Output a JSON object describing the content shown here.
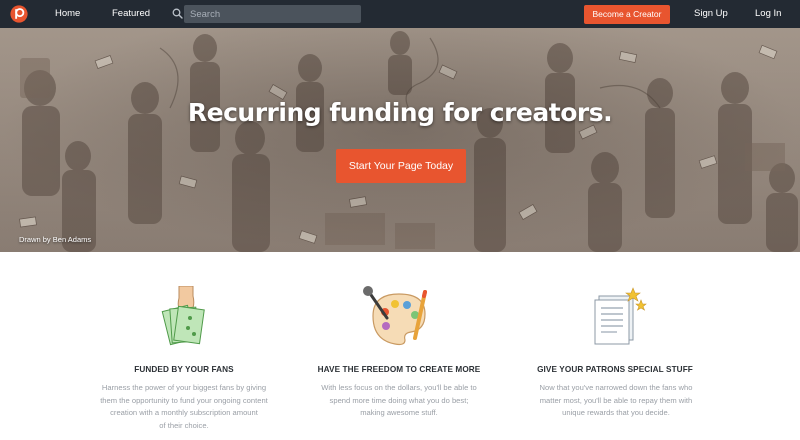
{
  "nav": {
    "home": "Home",
    "featured": "Featured",
    "search_placeholder": "Search",
    "become_creator": "Become a Creator",
    "signup": "Sign Up",
    "login": "Log In"
  },
  "hero": {
    "title": "Recurring funding for creators.",
    "cta": "Start Your Page Today",
    "credit_prefix": "Drawn by",
    "credit_name": "Ben Adams"
  },
  "features": [
    {
      "icon": "money-hand-icon",
      "title": "FUNDED BY YOUR FANS",
      "desc_lines": [
        "Harness the power of your biggest fans by giving",
        "them the opportunity to fund your ongoing content",
        "creation with a monthly subscription amount",
        "of their choice."
      ]
    },
    {
      "icon": "palette-microphone-icon",
      "title": "HAVE THE FREEDOM TO CREATE MORE",
      "desc_lines": [
        "With less focus on the dollars, you'll be able to",
        "spend more time doing what you do best;",
        "making awesome stuff."
      ]
    },
    {
      "icon": "certificate-stars-icon",
      "title": "GIVE YOUR PATRONS SPECIAL STUFF",
      "desc_lines": [
        "Now that you've narrowed down the fans who",
        "matter most, you'll be able to repay them with",
        "unique rewards that you decide."
      ]
    }
  ],
  "colors": {
    "nav_bg": "#232a33",
    "accent": "#e8552f",
    "search_bg": "#4b535c",
    "hero_tone": "#9c8f84",
    "feature_green": "#7cc576"
  }
}
